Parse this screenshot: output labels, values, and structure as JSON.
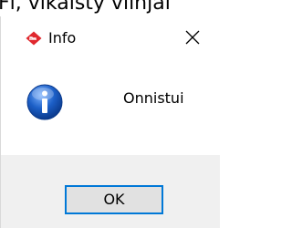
{
  "background": {
    "partial_title": "Fl, vlkaisty vlinjal"
  },
  "dialog": {
    "title": "Info",
    "message": "Onnistui",
    "ok_label": "OK",
    "icons": {
      "app": "app-logo-icon",
      "info": "info-icon",
      "close": "close-icon"
    },
    "colors": {
      "app_icon": "#e0282e",
      "info_blue": "#1c5fc7",
      "button_border": "#0078d7",
      "footer_bg": "#f0f0f0"
    }
  }
}
